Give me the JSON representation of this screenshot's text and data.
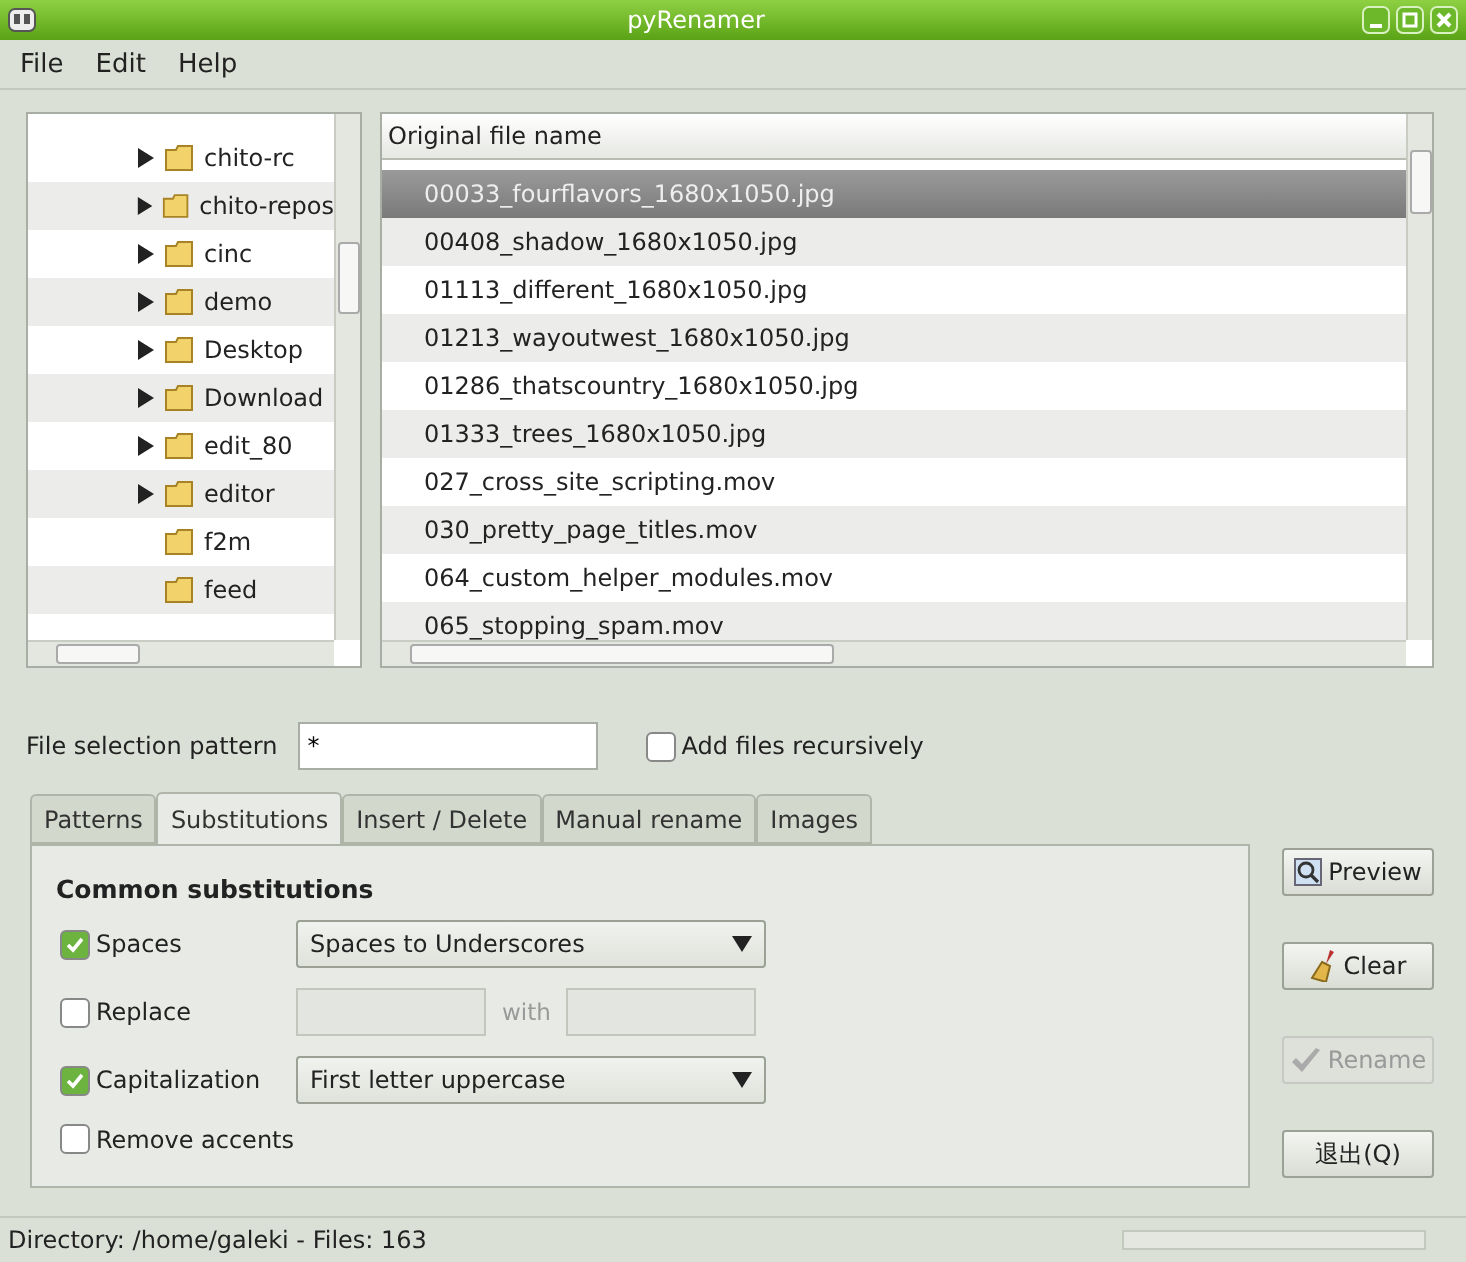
{
  "window": {
    "title": "pyRenamer"
  },
  "menu": [
    "File",
    "Edit",
    "Help"
  ],
  "tree": [
    {
      "name": "chito-rc",
      "expandable": true
    },
    {
      "name": "chito-repos",
      "expandable": true
    },
    {
      "name": "cinc",
      "expandable": true
    },
    {
      "name": "demo",
      "expandable": true
    },
    {
      "name": "Desktop",
      "expandable": true
    },
    {
      "name": "Download",
      "expandable": true
    },
    {
      "name": "edit_80",
      "expandable": true
    },
    {
      "name": "editor",
      "expandable": true
    },
    {
      "name": "f2m",
      "expandable": false
    },
    {
      "name": "feed",
      "expandable": false
    }
  ],
  "files": {
    "column": "Original file name",
    "rows": [
      {
        "name": "00033_fourflavors_1680x1050.jpg",
        "selected": true
      },
      {
        "name": "00408_shadow_1680x1050.jpg",
        "selected": false
      },
      {
        "name": "01113_different_1680x1050.jpg",
        "selected": false
      },
      {
        "name": "01213_wayoutwest_1680x1050.jpg",
        "selected": false
      },
      {
        "name": "01286_thatscountry_1680x1050.jpg",
        "selected": false
      },
      {
        "name": "01333_trees_1680x1050.jpg",
        "selected": false
      },
      {
        "name": "027_cross_site_scripting.mov",
        "selected": false
      },
      {
        "name": "030_pretty_page_titles.mov",
        "selected": false
      },
      {
        "name": "064_custom_helper_modules.mov",
        "selected": false
      },
      {
        "name": "065_stopping_spam.mov",
        "selected": false
      }
    ]
  },
  "pattern": {
    "label": "File selection pattern",
    "value": "*",
    "recursive_label": "Add files recursively",
    "recursive": false
  },
  "tabs": [
    {
      "label": "Patterns",
      "selected": false
    },
    {
      "label": "Substitutions",
      "selected": true
    },
    {
      "label": "Insert / Delete",
      "selected": false
    },
    {
      "label": "Manual rename",
      "selected": false
    },
    {
      "label": "Images",
      "selected": false
    }
  ],
  "substitutions": {
    "heading": "Common substitutions",
    "rows": [
      {
        "kind": "select",
        "label": "Spaces",
        "checked": true,
        "value": "Spaces to Underscores"
      },
      {
        "kind": "replace",
        "label": "Replace",
        "checked": false,
        "with": "with"
      },
      {
        "kind": "select",
        "label": "Capitalization",
        "checked": true,
        "value": "First letter uppercase"
      },
      {
        "kind": "plain",
        "label": "Remove accents",
        "checked": false
      }
    ]
  },
  "buttons": [
    {
      "kind": "preview",
      "label": "Preview",
      "disabled": false
    },
    {
      "kind": "clear",
      "label": "Clear",
      "disabled": false
    },
    {
      "kind": "rename",
      "label": "Rename",
      "disabled": true
    },
    {
      "kind": "quit",
      "label": "退出(Q)",
      "disabled": false
    }
  ],
  "status_bar": "Directory: /home/galeki - Files: 163"
}
